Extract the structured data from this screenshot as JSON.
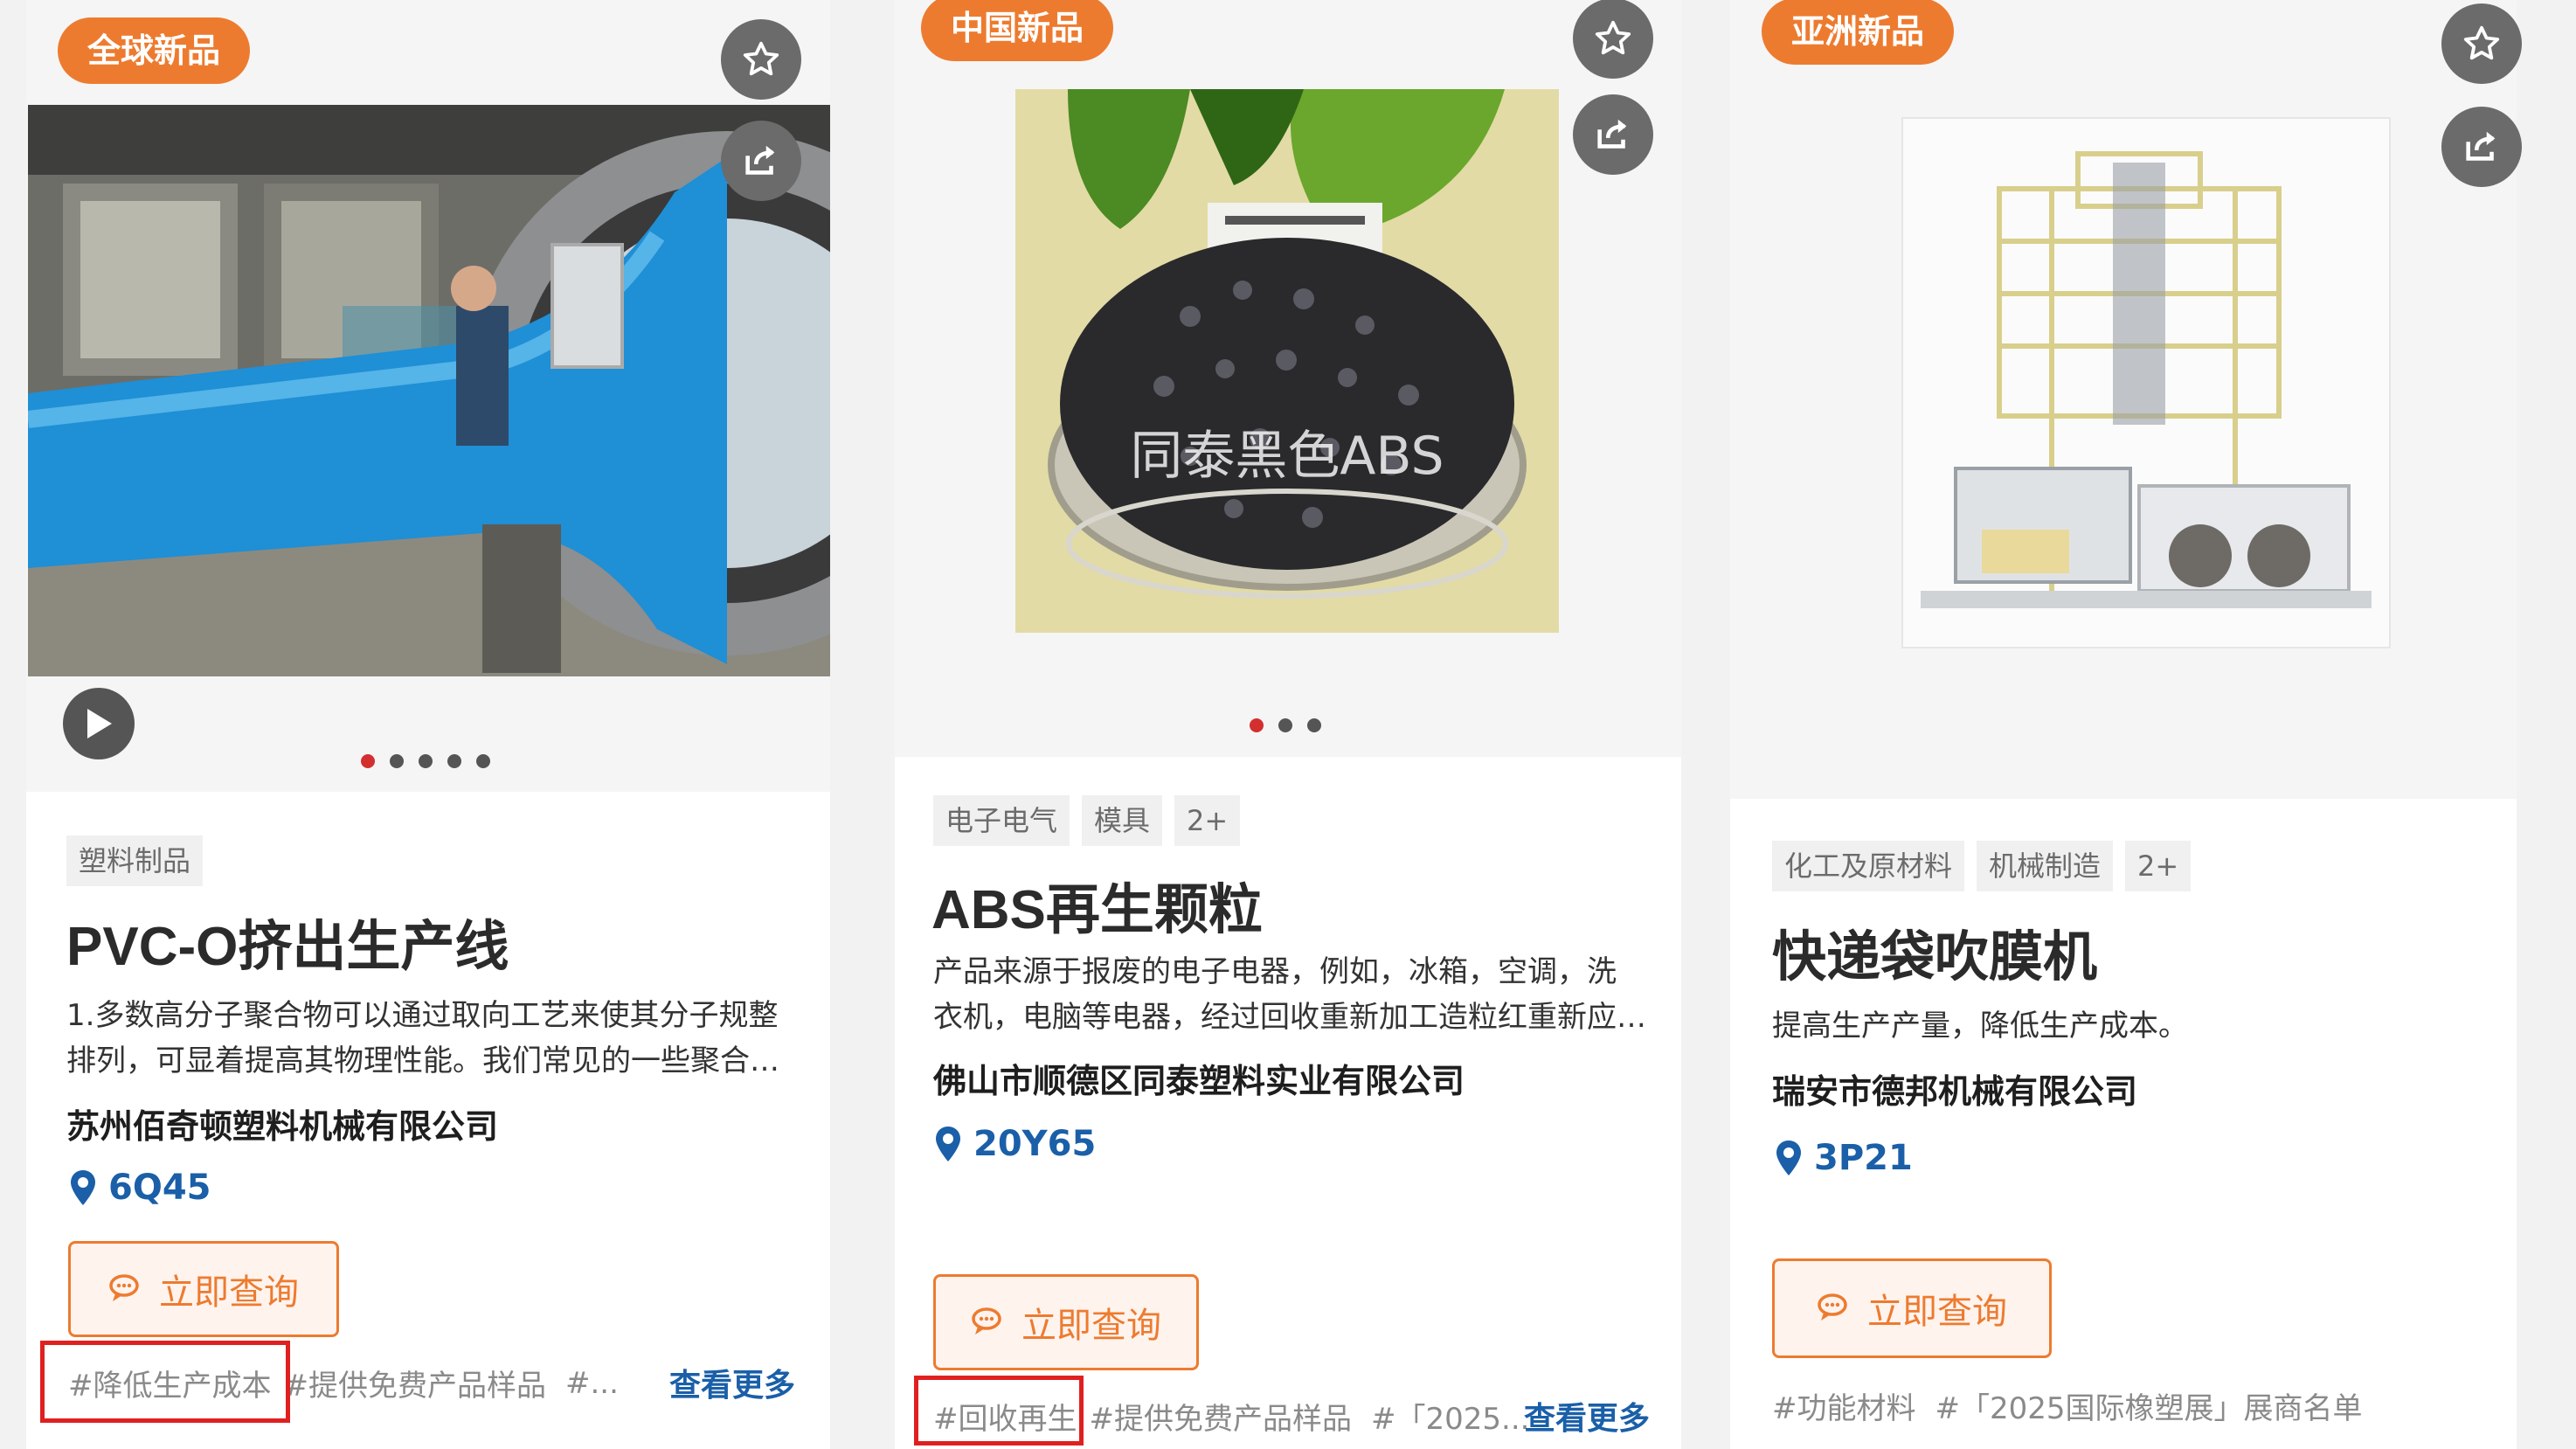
{
  "colors": {
    "accent": "#ed7b2f",
    "link": "#1a5fa8",
    "highlight_box": "#e02020"
  },
  "cards": [
    {
      "badge": "全球新品",
      "tags": [
        "塑料制品"
      ],
      "title": "PVC-O挤出生产线",
      "desc_line1": "1.多数高分子聚合物可以通过取向工艺来使其分子规整",
      "desc_line2": "排列，可显着提高其物理性能。我们常见的一些聚合…",
      "company": "苏州佰奇顿塑料机械有限公司",
      "booth": "6Q45",
      "inquiry": "立即查询",
      "hashtags": [
        "#降低生产成本",
        "#提供免费产品样品",
        "#..."
      ],
      "more": "查看更多",
      "carousel_count": 5,
      "carousel_active": 0
    },
    {
      "badge": "中国新品",
      "tags": [
        "电子电气",
        "模具",
        "2+"
      ],
      "title": "ABS再生颗粒",
      "photo_overlay": "同泰黑色ABS",
      "desc_line1": "产品来源于报废的电子电器，例如，冰箱，空调，洗",
      "desc_line2": "衣机，电脑等电器，经过回收重新加工造粒红重新应…",
      "company": "佛山市顺德区同泰塑料实业有限公司",
      "booth": "20Y65",
      "inquiry": "立即查询",
      "hashtags": [
        "#回收再生",
        "#提供免费产品样品",
        "#「2025..."
      ],
      "more": "查看更多",
      "carousel_count": 3,
      "carousel_active": 0
    },
    {
      "badge": "亚洲新品",
      "tags": [
        "化工及原材料",
        "机械制造",
        "2+"
      ],
      "title": "快递袋吹膜机",
      "desc_line1": "提高生产产量，降低生产成本。",
      "company": "瑞安市德邦机械有限公司",
      "booth": "3P21",
      "inquiry": "立即查询",
      "hashtags": [
        "#功能材料",
        "#「2025国际橡塑展」展商名单"
      ]
    }
  ]
}
